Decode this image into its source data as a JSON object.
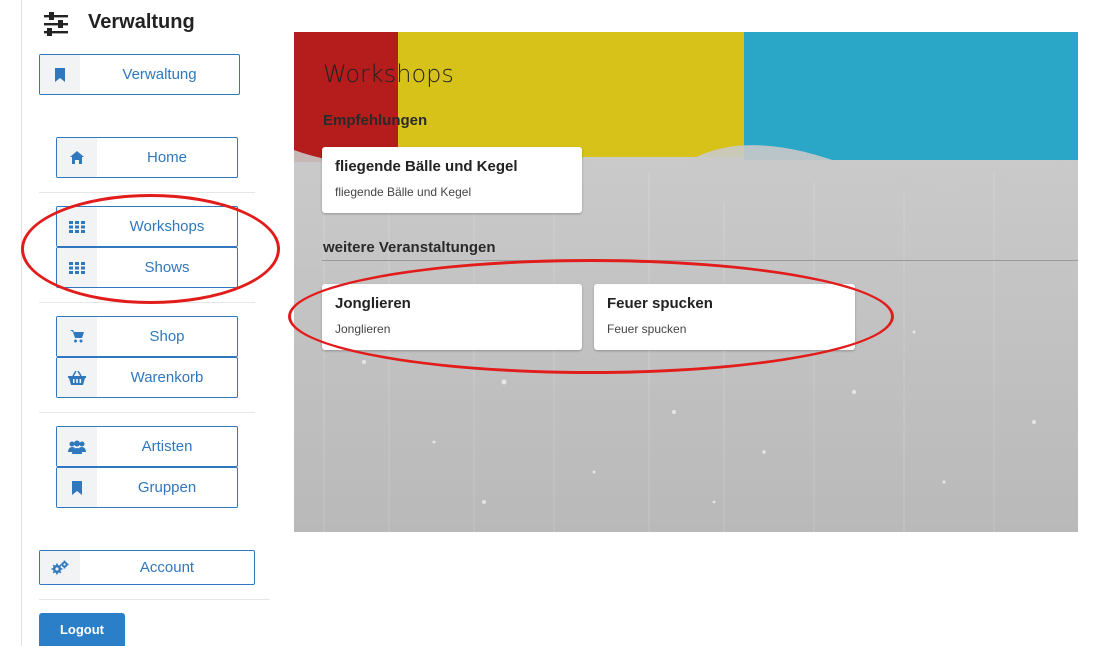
{
  "brand": {
    "title": "Verwaltung",
    "icon": "sliders-icon"
  },
  "sidebar": {
    "admin_button": {
      "label": "Verwaltung",
      "icon": "bookmark-icon"
    },
    "groups": [
      [
        {
          "label": "Home",
          "icon": "home-icon"
        }
      ],
      [
        {
          "label": "Workshops",
          "icon": "grid-icon"
        },
        {
          "label": "Shows",
          "icon": "grid-icon"
        }
      ],
      [
        {
          "label": "Shop",
          "icon": "cart-icon"
        },
        {
          "label": "Warenkorb",
          "icon": "basket-icon"
        }
      ],
      [
        {
          "label": "Artisten",
          "icon": "users-icon"
        },
        {
          "label": "Gruppen",
          "icon": "bookmark-icon"
        }
      ]
    ],
    "account": {
      "label": "Account",
      "icon": "gears-icon"
    },
    "logout": {
      "label": "Logout"
    }
  },
  "main": {
    "title": "Workshops",
    "recommendations": {
      "heading": "Empfehlungen",
      "cards": [
        {
          "title": "fliegende Bälle und Kegel",
          "subtitle": "fliegende Bälle und Kegel"
        }
      ]
    },
    "more_events": {
      "heading": "weitere Veranstaltungen",
      "cards": [
        {
          "title": "Jonglieren",
          "subtitle": "Jonglieren"
        },
        {
          "title": "Feuer spucken",
          "subtitle": "Feuer spucken"
        }
      ]
    }
  },
  "colors": {
    "accent": "#2f78bd",
    "annotation": "#e21b1b",
    "hero_red": "#b51c1c",
    "hero_yellow": "#d7c21a",
    "hero_cyan": "#2aa7c7"
  }
}
